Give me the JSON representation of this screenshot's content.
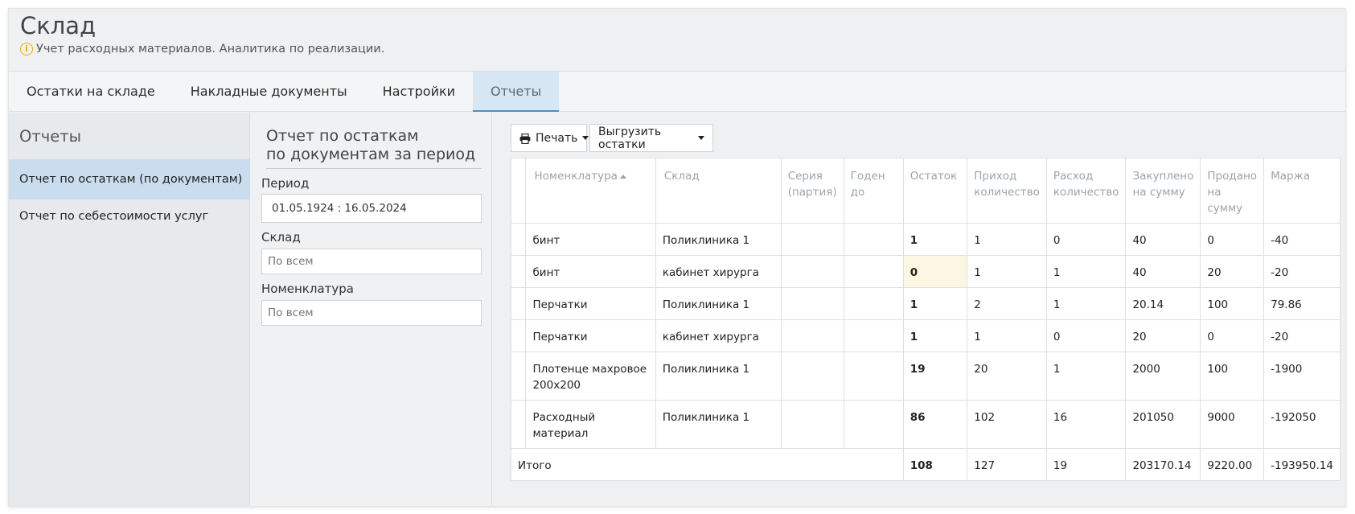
{
  "header": {
    "title": "Склад",
    "subtitle": "Учет расходных материалов. Аналитика по реализации.",
    "info_icon": "info-icon"
  },
  "tabs": [
    {
      "label": "Остатки на складе",
      "active": false
    },
    {
      "label": "Накладные документы",
      "active": false
    },
    {
      "label": "Настройки",
      "active": false
    },
    {
      "label": "Отчеты",
      "active": true
    }
  ],
  "sidebar": {
    "title": "Отчеты",
    "items": [
      {
        "label": "Отчет по остаткам (по документам)",
        "active": true
      },
      {
        "label": "Отчет по себестоимости услуг",
        "active": false
      }
    ]
  },
  "filters": {
    "title_line1": "Отчет по остаткам",
    "title_line2": "по документам за период",
    "period_label": "Период",
    "period_value": "01.05.1924  :  16.05.2024",
    "warehouse_label": "Склад",
    "warehouse_value": "По всем",
    "nomenclature_label": "Номенклатура",
    "nomenclature_value": "По всем"
  },
  "toolbar": {
    "print_label": "Печать",
    "export_label": "Выгрузить остатки"
  },
  "table": {
    "headers": [
      "",
      "Номенклатура",
      "Склад",
      "Серия (партия)",
      "Годен до",
      "Остаток",
      "Приход количество",
      "Расход количество",
      "Закуплено на сумму",
      "Продано на сумму",
      "Маржа"
    ],
    "rows": [
      {
        "name": "бинт",
        "warehouse": "Поликлиника 1",
        "series": "",
        "expiry": "",
        "rest": "1",
        "income": "1",
        "expense": "0",
        "purchased": "40",
        "sold": "0",
        "margin": "-40"
      },
      {
        "name": "бинт",
        "warehouse": "кабинет хирурга",
        "series": "",
        "expiry": "",
        "rest": "0",
        "income": "1",
        "expense": "1",
        "purchased": "40",
        "sold": "20",
        "margin": "-20"
      },
      {
        "name": "Перчатки",
        "warehouse": "Поликлиника 1",
        "series": "",
        "expiry": "",
        "rest": "1",
        "income": "2",
        "expense": "1",
        "purchased": "20.14",
        "sold": "100",
        "margin": "79.86"
      },
      {
        "name": "Перчатки",
        "warehouse": "кабинет хирурга",
        "series": "",
        "expiry": "",
        "rest": "1",
        "income": "1",
        "expense": "0",
        "purchased": "20",
        "sold": "0",
        "margin": "-20"
      },
      {
        "name": "Плотенце махровое 200х200",
        "warehouse": "Поликлиника 1",
        "series": "",
        "expiry": "",
        "rest": "19",
        "income": "20",
        "expense": "1",
        "purchased": "2000",
        "sold": "100",
        "margin": "-1900"
      },
      {
        "name": "Расходный материал",
        "warehouse": "Поликлиника 1",
        "series": "",
        "expiry": "",
        "rest": "86",
        "income": "102",
        "expense": "16",
        "purchased": "201050",
        "sold": "9000",
        "margin": "-192050"
      }
    ],
    "total": {
      "label": "Итого",
      "rest": "108",
      "income": "127",
      "expense": "19",
      "purchased": "203170.14",
      "sold": "9220.00",
      "margin": "-193950.14"
    }
  }
}
